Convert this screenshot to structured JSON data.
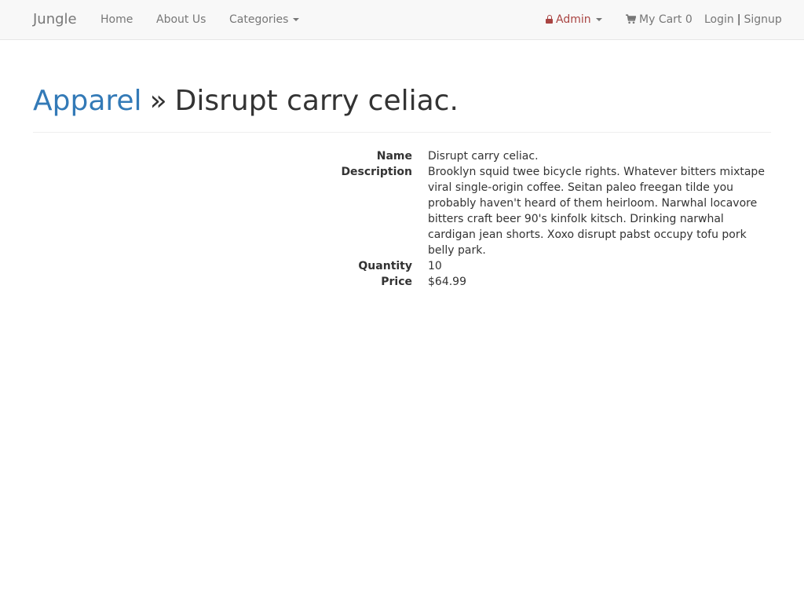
{
  "nav": {
    "brand": "Jungle",
    "home": "Home",
    "about": "About Us",
    "categories": "Categories",
    "admin": "Admin",
    "cart_label": "My Cart",
    "cart_count": "0",
    "login": "Login",
    "separator": "|",
    "signup": "Signup"
  },
  "header": {
    "category": "Apparel",
    "separator": "»",
    "title": "Disrupt carry celiac."
  },
  "product": {
    "name_label": "Name",
    "name": "Disrupt carry celiac.",
    "description_label": "Description",
    "description": "Brooklyn squid twee bicycle rights. Whatever bitters mixtape viral single-origin coffee. Seitan paleo freegan tilde you probably haven't heard of them heirloom. Narwhal locavore bitters craft beer 90's kinfolk kitsch. Drinking narwhal cardigan jean shorts. Xoxo disrupt pabst occupy tofu pork belly park.",
    "quantity_label": "Quantity",
    "quantity": "10",
    "price_label": "Price",
    "price": "$64.99"
  },
  "colors": {
    "link": "#337ab7",
    "admin": "#a94442",
    "navbar_bg": "#f8f8f8"
  },
  "icons": {
    "admin": "lock-icon",
    "cart": "shopping-cart-icon",
    "dropdown": "caret-down-icon"
  }
}
